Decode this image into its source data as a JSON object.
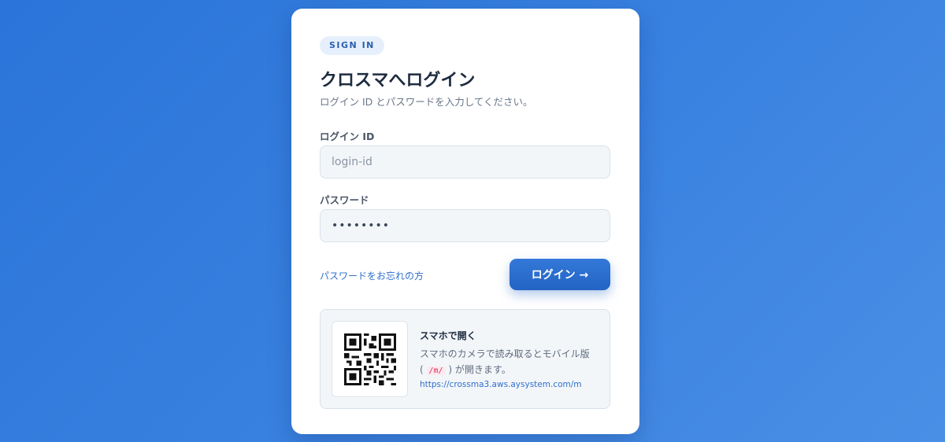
{
  "login": {
    "badge": "SIGN IN",
    "title": "クロスマへログイン",
    "subtitle": "ログイン ID とパスワードを入力してください。",
    "id_label": "ログイン ID",
    "id_placeholder": "login-id",
    "id_value": "",
    "password_label": "パスワード",
    "password_value": "••••••••",
    "forgot_link": "パスワードをお忘れの方",
    "submit_label": "ログイン →"
  },
  "mobile": {
    "title": "スマホで開く",
    "desc_before": "スマホのカメラで読み取るとモバイル版",
    "desc_open": "(",
    "desc_code": "/m/",
    "desc_after": ") が開きます。",
    "url": "https://crossma3.aws.aysystem.com/m",
    "qr_icon": "qr-code-icon"
  },
  "colors": {
    "accent": "#2b6fd0",
    "background_start": "#2b74d9",
    "background_end": "#4a8fe6",
    "code": "#d6335a"
  }
}
